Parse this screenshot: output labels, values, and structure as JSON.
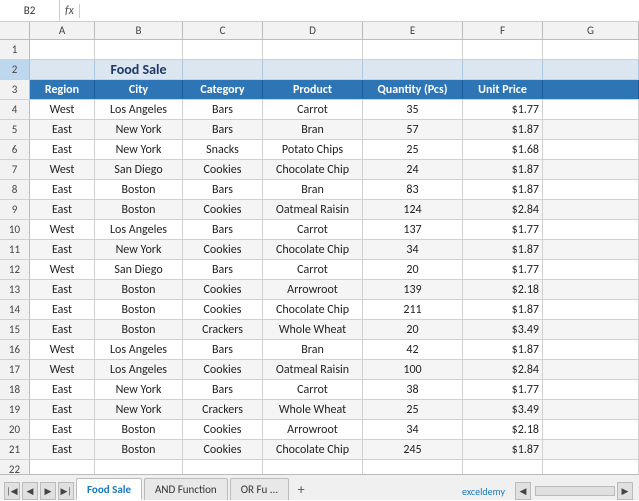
{
  "nameBox": "B2",
  "formulaBar": "",
  "fxLabel": "fx",
  "colHeaders": [
    "",
    "A",
    "B",
    "C",
    "D",
    "E",
    "F",
    "G"
  ],
  "titleRow": {
    "rowNum": "2",
    "value": "Food Sale",
    "colspan": 6
  },
  "headerRow": {
    "rowNum": "3",
    "cols": [
      "Region",
      "City",
      "Category",
      "Product",
      "Quantity (Pcs)",
      "Unit Price"
    ]
  },
  "rows": [
    {
      "num": "4",
      "region": "West",
      "city": "Los Angeles",
      "category": "Bars",
      "product": "Carrot",
      "qty": "35",
      "price": "$1.77"
    },
    {
      "num": "5",
      "region": "East",
      "city": "New York",
      "category": "Bars",
      "product": "Bran",
      "qty": "57",
      "price": "$1.87"
    },
    {
      "num": "6",
      "region": "East",
      "city": "New York",
      "category": "Snacks",
      "product": "Potato Chips",
      "qty": "25",
      "price": "$1.68"
    },
    {
      "num": "7",
      "region": "West",
      "city": "San Diego",
      "category": "Cookies",
      "product": "Chocolate Chip",
      "qty": "24",
      "price": "$1.87"
    },
    {
      "num": "8",
      "region": "East",
      "city": "Boston",
      "category": "Bars",
      "product": "Bran",
      "qty": "83",
      "price": "$1.87"
    },
    {
      "num": "9",
      "region": "East",
      "city": "Boston",
      "category": "Cookies",
      "product": "Oatmeal Raisin",
      "qty": "124",
      "price": "$2.84"
    },
    {
      "num": "10",
      "region": "West",
      "city": "Los Angeles",
      "category": "Bars",
      "product": "Carrot",
      "qty": "137",
      "price": "$1.77"
    },
    {
      "num": "11",
      "region": "East",
      "city": "New York",
      "category": "Cookies",
      "product": "Chocolate Chip",
      "qty": "34",
      "price": "$1.87"
    },
    {
      "num": "12",
      "region": "West",
      "city": "San Diego",
      "category": "Bars",
      "product": "Carrot",
      "qty": "20",
      "price": "$1.77"
    },
    {
      "num": "13",
      "region": "East",
      "city": "Boston",
      "category": "Cookies",
      "product": "Arrowroot",
      "qty": "139",
      "price": "$2.18"
    },
    {
      "num": "14",
      "region": "East",
      "city": "Boston",
      "category": "Cookies",
      "product": "Chocolate Chip",
      "qty": "211",
      "price": "$1.87"
    },
    {
      "num": "15",
      "region": "East",
      "city": "Boston",
      "category": "Crackers",
      "product": "Whole Wheat",
      "qty": "20",
      "price": "$3.49"
    },
    {
      "num": "16",
      "region": "West",
      "city": "Los Angeles",
      "category": "Bars",
      "product": "Bran",
      "qty": "42",
      "price": "$1.87"
    },
    {
      "num": "17",
      "region": "West",
      "city": "Los Angeles",
      "category": "Cookies",
      "product": "Oatmeal Raisin",
      "qty": "100",
      "price": "$2.84"
    },
    {
      "num": "18",
      "region": "East",
      "city": "New York",
      "category": "Bars",
      "product": "Carrot",
      "qty": "38",
      "price": "$1.77"
    },
    {
      "num": "19",
      "region": "East",
      "city": "New York",
      "category": "Crackers",
      "product": "Whole Wheat",
      "qty": "25",
      "price": "$3.49"
    },
    {
      "num": "20",
      "region": "East",
      "city": "Boston",
      "category": "Cookies",
      "product": "Arrowroot",
      "qty": "34",
      "price": "$2.18"
    },
    {
      "num": "21",
      "region": "East",
      "city": "Boston",
      "category": "Cookies",
      "product": "Chocolate Chip",
      "qty": "245",
      "price": "$1.87"
    }
  ],
  "emptyRows": [
    "1",
    "22"
  ],
  "tabs": [
    {
      "label": "Food Sale",
      "active": true
    },
    {
      "label": "AND Function",
      "active": false
    },
    {
      "label": "OR Fu ...",
      "active": false
    }
  ],
  "brand": "exceldemy",
  "colors": {
    "headerBg": "#2e75b6",
    "titleBg": "#dce6f1",
    "activeTab": "#1a7abf"
  }
}
